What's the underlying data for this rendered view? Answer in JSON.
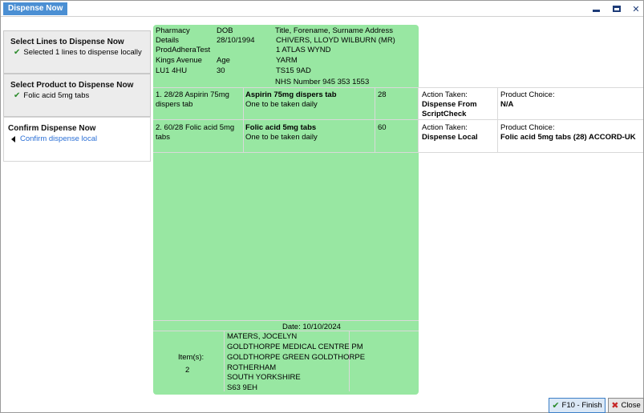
{
  "window": {
    "title": "Dispense Now"
  },
  "sidebar": {
    "steps": [
      {
        "title": "Select Lines to Dispense Now",
        "detail": "Selected 1 lines to dispense locally"
      },
      {
        "title": "Select Product to Dispense Now",
        "detail": "Folic acid 5mg tabs"
      },
      {
        "title": "Confirm Dispense Now",
        "detail": "Confirm dispense local"
      }
    ]
  },
  "header": {
    "pharmacy_label": "Pharmacy",
    "details_label": "Details",
    "pharmacy_name": "ProdAdheraTest",
    "pharmacy_street": "Kings Avenue",
    "pharmacy_postcode": "LU1 4HU",
    "dob_label": "DOB",
    "dob_value": "28/10/1994",
    "age_label": "Age",
    "age_value": "30",
    "patient_header": "Title, Forename, Surname Address",
    "patient_name": "CHIVERS, LLOYD WILBURN (MR)",
    "patient_addr1": "1 ATLAS WYND",
    "patient_addr2": "YARM",
    "patient_postcode": "TS15 9AD",
    "nhs_number": "NHS Number 945 353 1553"
  },
  "lines": [
    {
      "label": "1. 28/28 Aspirin 75mg dispers tab",
      "drug": "Aspirin 75mg dispers tab",
      "dose": "One to be taken daily",
      "qty": "28",
      "action_label": "Action Taken:",
      "action_value": "Dispense From ScriptCheck",
      "product_label": "Product Choice:",
      "product_value": "N/A"
    },
    {
      "label": "2. 60/28 Folic acid 5mg tabs",
      "drug": "Folic acid 5mg tabs",
      "dose": "One to be taken daily",
      "qty": "60",
      "action_label": "Action Taken:",
      "action_value": "Dispense Local",
      "product_label": "Product Choice:",
      "product_value": "Folic acid 5mg tabs (28) ACCORD-UK"
    }
  ],
  "footer": {
    "date": "Date:  10/10/2024",
    "items_label": "Item(s):",
    "items_count": "2",
    "prescriber": "MATERS, JOCELYN",
    "practice": "GOLDTHORPE MEDICAL CENTRE PM",
    "addr1": "GOLDTHORPE GREEN GOLDTHORPE",
    "addr2": "ROTHERHAM",
    "addr3": "SOUTH YORKSHIRE",
    "postcode": "S63 9EH"
  },
  "buttons": {
    "finish": "F10 - Finish",
    "close": "Close"
  }
}
